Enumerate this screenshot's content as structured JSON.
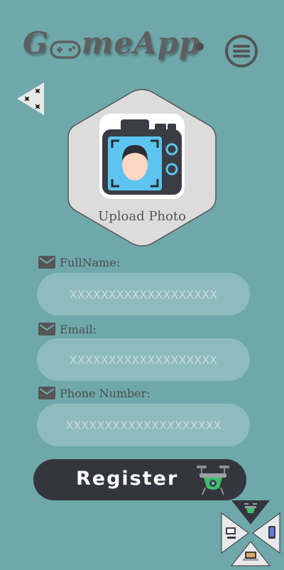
{
  "header": {
    "logo_prefix": "G",
    "logo_suffix": "meApp",
    "logo_icon": "gamepad-icon",
    "menu_icon": "hamburger-menu-icon",
    "back_icon": "back-arrow-icon"
  },
  "upload": {
    "label": "Upload Photo",
    "icon": "camera-face-icon"
  },
  "form": {
    "fullname": {
      "label": "FullName:",
      "placeholder": "XXXXXXXXXXXXXXXXXXX"
    },
    "email": {
      "label": "Email:",
      "placeholder": "XXXXXXXXXXXXXXXXXXX"
    },
    "phone": {
      "label": "Phone Number:",
      "placeholder": "XXXXXXXXXXXXXXXXXXXX"
    }
  },
  "register": {
    "label": "Register",
    "icon": "drone-icon"
  },
  "corner_widget": {
    "icons": [
      "drone-icon",
      "phone-icon",
      "desktop-icon",
      "laptop-icon"
    ]
  },
  "colors": {
    "background": "#6fa8ab",
    "button": "#34363d",
    "hexagon": "#dcdcdc",
    "text": "#4d4d4d"
  }
}
